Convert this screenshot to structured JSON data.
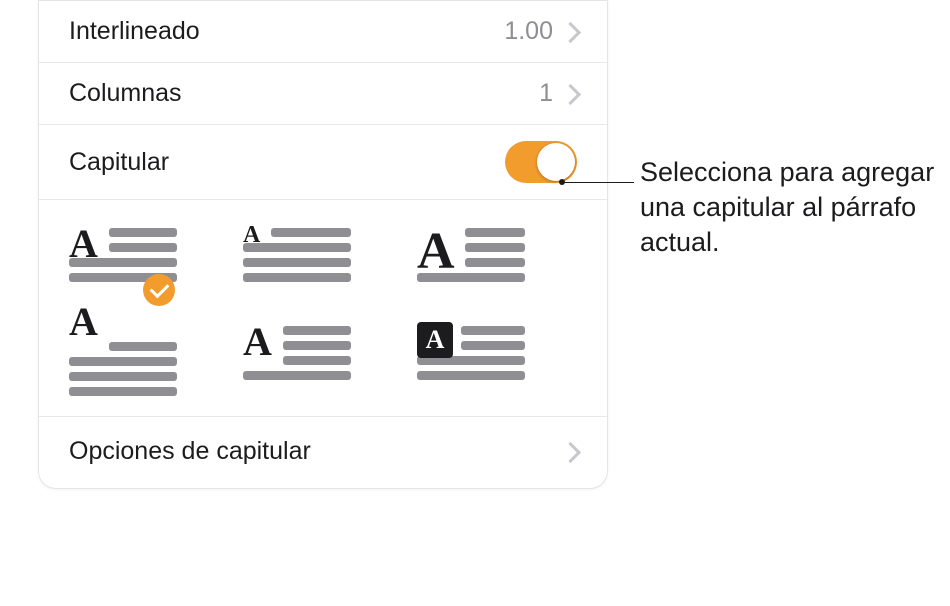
{
  "rows": {
    "line_spacing": {
      "label": "Interlineado",
      "value": "1.00"
    },
    "columns": {
      "label": "Columnas",
      "value": "1"
    },
    "dropcap": {
      "label": "Capitular",
      "enabled": true
    }
  },
  "dropcap_styles": [
    {
      "id": "style1",
      "selected": true
    },
    {
      "id": "style2",
      "selected": false
    },
    {
      "id": "style3",
      "selected": false
    },
    {
      "id": "style4",
      "selected": false
    },
    {
      "id": "style5",
      "selected": false
    },
    {
      "id": "style6",
      "selected": false
    }
  ],
  "options_row": {
    "label": "Opciones de capitular"
  },
  "callout": "Selecciona para agregar una capitular al párrafo actual.",
  "colors": {
    "accent": "#f39c2e"
  }
}
